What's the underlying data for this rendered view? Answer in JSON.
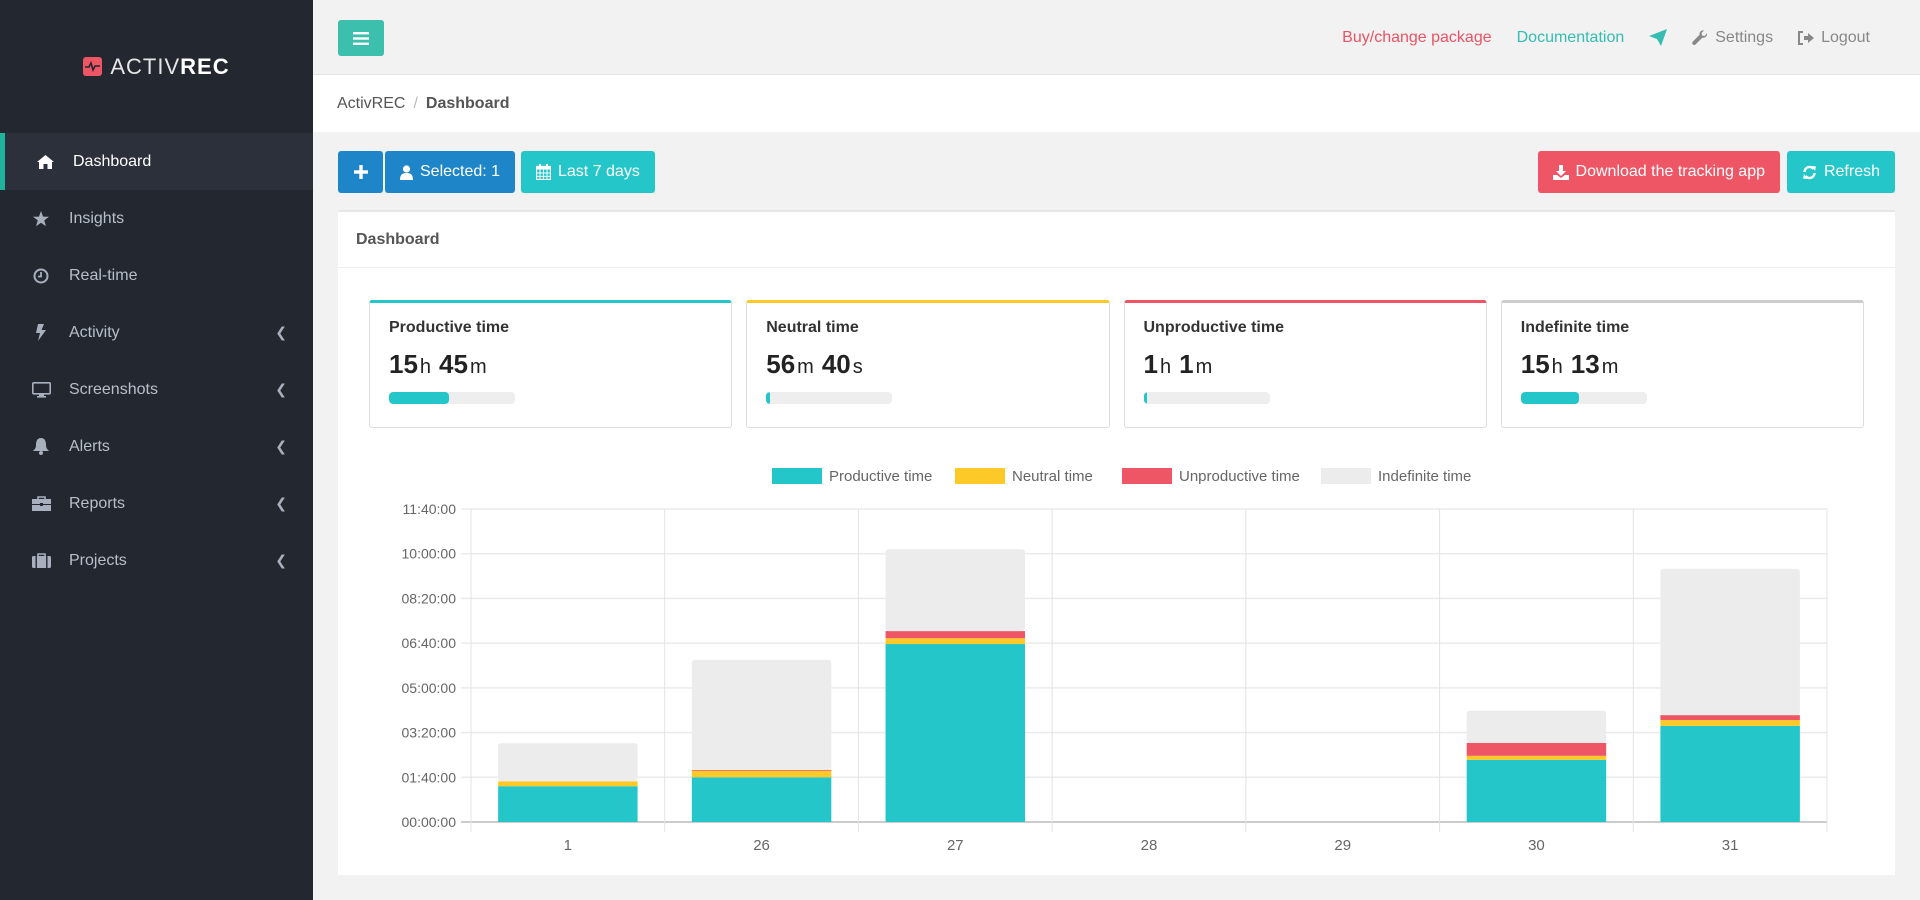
{
  "app": {
    "logo_light": "ACTIV",
    "logo_bold": "REC",
    "brand_color": "#ee5565"
  },
  "sidebar": {
    "items": [
      {
        "label": "Dashboard",
        "icon": "home-icon",
        "active": true,
        "has_children": false
      },
      {
        "label": "Insights",
        "icon": "star-icon",
        "active": false,
        "has_children": false
      },
      {
        "label": "Real-time",
        "icon": "clock-icon",
        "active": false,
        "has_children": false
      },
      {
        "label": "Activity",
        "icon": "bolt-icon",
        "active": false,
        "has_children": true
      },
      {
        "label": "Screenshots",
        "icon": "desktop-icon",
        "active": false,
        "has_children": true
      },
      {
        "label": "Alerts",
        "icon": "bell-icon",
        "active": false,
        "has_children": true
      },
      {
        "label": "Reports",
        "icon": "toolbox-icon",
        "active": false,
        "has_children": true
      },
      {
        "label": "Projects",
        "icon": "suitcase-icon",
        "active": false,
        "has_children": true
      }
    ]
  },
  "topbar": {
    "buy_label": "Buy/change package",
    "docs_label": "Documentation",
    "settings_label": "Settings",
    "logout_label": "Logout"
  },
  "breadcrumb": {
    "root": "ActivREC",
    "separator": "/",
    "current": "Dashboard"
  },
  "toolbar": {
    "add_icon": "plus-icon",
    "selected_label": "Selected: 1",
    "range_label": "Last 7 days",
    "download_label": "Download the tracking app",
    "refresh_label": "Refresh"
  },
  "panel": {
    "title": "Dashboard"
  },
  "cards": [
    {
      "title": "Productive time",
      "parts": [
        {
          "n": "15",
          "u": "h"
        },
        {
          "n": "45",
          "u": "m"
        }
      ],
      "progress_pct": 48,
      "color": "#25c6c9"
    },
    {
      "title": "Neutral time",
      "parts": [
        {
          "n": "56",
          "u": "m"
        },
        {
          "n": "40",
          "u": "s"
        }
      ],
      "progress_pct": 3,
      "color": "#fdc928"
    },
    {
      "title": "Unproductive time",
      "parts": [
        {
          "n": "1",
          "u": "h"
        },
        {
          "n": "1",
          "u": "m"
        }
      ],
      "progress_pct": 3,
      "color": "#ee5565"
    },
    {
      "title": "Indefinite time",
      "parts": [
        {
          "n": "15",
          "u": "h"
        },
        {
          "n": "13",
          "u": "m"
        }
      ],
      "progress_pct": 46,
      "color": "#cccccc"
    }
  ],
  "chart_data": {
    "type": "bar",
    "stacked": true,
    "title": "",
    "xlabel": "",
    "ylabel": "",
    "categories": [
      "1",
      "26",
      "27",
      "28",
      "29",
      "30",
      "31"
    ],
    "y_unit": "minutes",
    "ylim": [
      0,
      700
    ],
    "y_ticks": [
      0,
      100,
      200,
      300,
      400,
      500,
      600,
      700
    ],
    "y_tick_labels": [
      "00:00:00",
      "01:40:00",
      "03:20:00",
      "05:00:00",
      "06:40:00",
      "08:20:00",
      "10:00:00",
      "11:40:00"
    ],
    "grid": true,
    "legend_position": "top",
    "series": [
      {
        "name": "Productive time",
        "color": "#25c6c9",
        "values": [
          80,
          100,
          398,
          0,
          0,
          139,
          215
        ]
      },
      {
        "name": "Neutral time",
        "color": "#fdc928",
        "values": [
          11,
          15,
          13,
          0,
          0,
          9,
          13
        ]
      },
      {
        "name": "Unproductive time",
        "color": "#ee5565",
        "values": [
          0,
          1.5,
          16,
          0,
          0,
          29,
          11
        ]
      },
      {
        "name": "Indefinite time",
        "color": "#ececec",
        "values": [
          85,
          246,
          183,
          0,
          0,
          72,
          327
        ]
      }
    ]
  }
}
